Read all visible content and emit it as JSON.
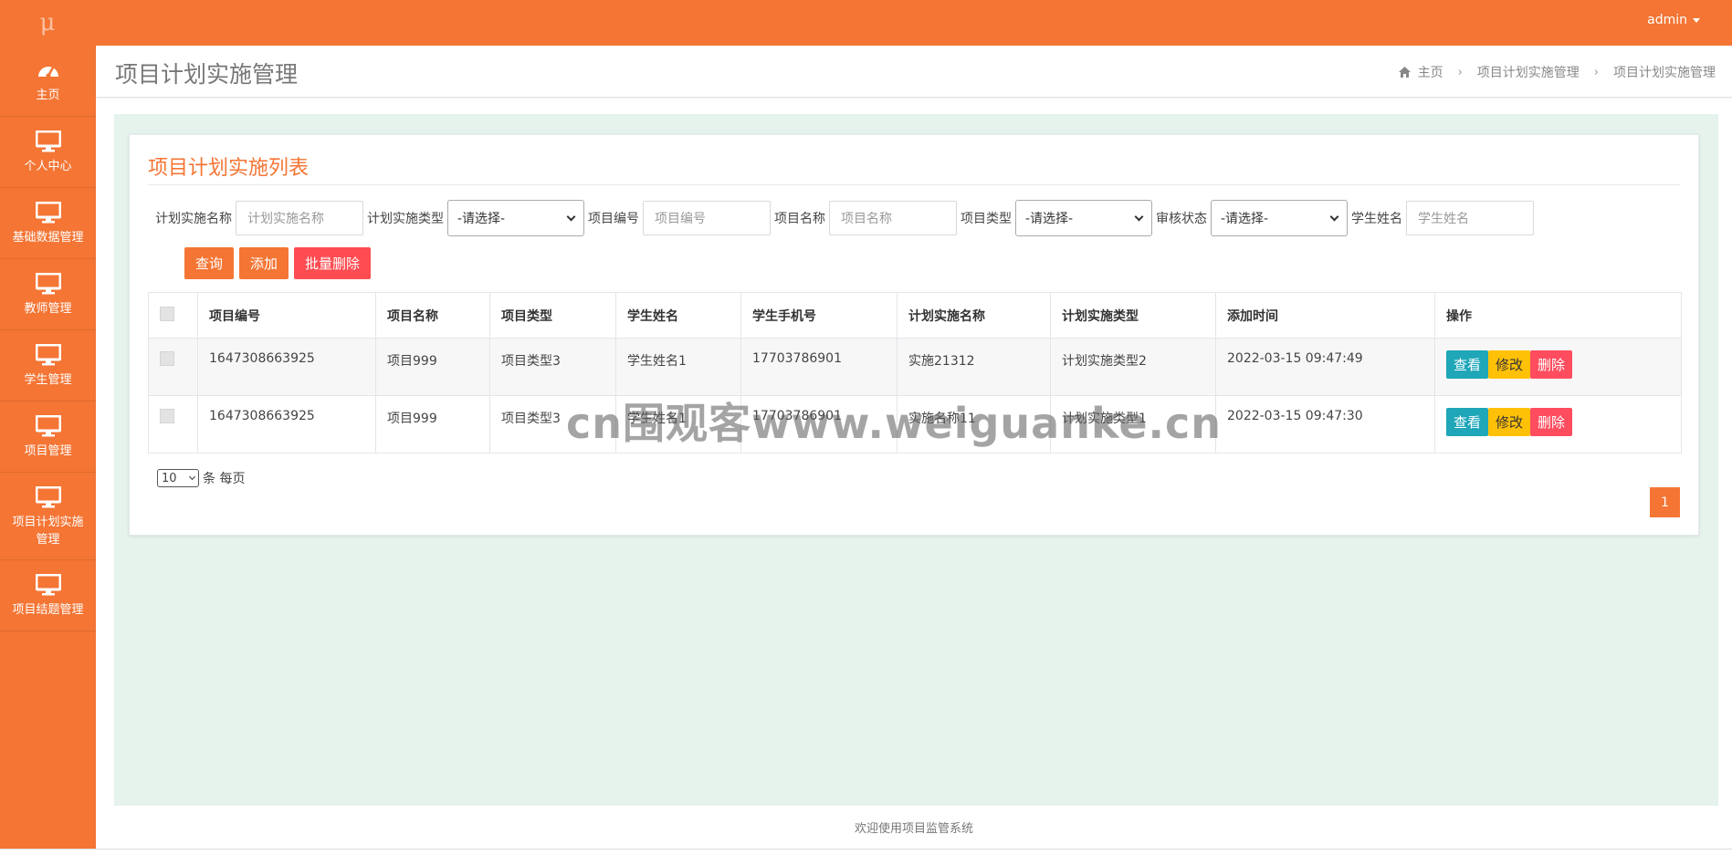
{
  "app": {
    "logo": "μ",
    "user": "admin"
  },
  "sidebar": {
    "items": [
      {
        "label": "主页",
        "icon": "dashboard-icon"
      },
      {
        "label": "个人中心",
        "icon": "monitor-icon"
      },
      {
        "label": "基础数据管理",
        "icon": "monitor-icon"
      },
      {
        "label": "教师管理",
        "icon": "monitor-icon"
      },
      {
        "label": "学生管理",
        "icon": "monitor-icon"
      },
      {
        "label": "项目管理",
        "icon": "monitor-icon"
      },
      {
        "label": "项目计划实施管理",
        "icon": "monitor-icon"
      },
      {
        "label": "项目结题管理",
        "icon": "monitor-icon"
      }
    ]
  },
  "header": {
    "title": "项目计划实施管理",
    "breadcrumb": [
      "主页",
      "项目计划实施管理",
      "项目计划实施管理"
    ]
  },
  "panel": {
    "title": "项目计划实施列表"
  },
  "filters": [
    {
      "label": "计划实施名称",
      "placeholder": "计划实施名称"
    },
    {
      "label": "计划实施类型",
      "select": "-请选择-"
    },
    {
      "label": "项目编号",
      "placeholder": "项目编号"
    },
    {
      "label": "项目名称",
      "placeholder": "项目名称"
    },
    {
      "label": "项目类型",
      "select": "-请选择-"
    },
    {
      "label": "审核状态",
      "select": "-请选择-"
    },
    {
      "label": "学生姓名",
      "placeholder": "学生姓名"
    }
  ],
  "actions": {
    "query": "查询",
    "add": "添加",
    "batch_delete": "批量删除"
  },
  "table": {
    "columns": [
      "项目编号",
      "项目名称",
      "项目类型",
      "学生姓名",
      "学生手机号",
      "计划实施名称",
      "计划实施类型",
      "添加时间",
      "操作"
    ],
    "rows": [
      [
        "1647308663925",
        "项目999",
        "项目类型3",
        "学生姓名1",
        "17703786901",
        "实施21312",
        "计划实施类型2",
        "2022-03-15 09:47:49"
      ],
      [
        "1647308663925",
        "项目999",
        "项目类型3",
        "学生姓名1",
        "17703786901",
        "实施名称11",
        "计划实施类型1",
        "2022-03-15 09:47:30"
      ]
    ],
    "row_actions": {
      "view": "查看",
      "edit": "修改",
      "delete": "删除"
    }
  },
  "pagination": {
    "page_size": "10",
    "page_size_suffix": "条 每页",
    "current_page": "1"
  },
  "footer": {
    "text": "欢迎使用项目监管系统"
  },
  "watermark": "cn围观客www.weiguanke.cn",
  "colors": {
    "primary": "#f47534",
    "danger": "#ff4c52",
    "info": "#1fa6b8",
    "warning": "#ffc107",
    "content_bg": "#e6f2ec"
  }
}
